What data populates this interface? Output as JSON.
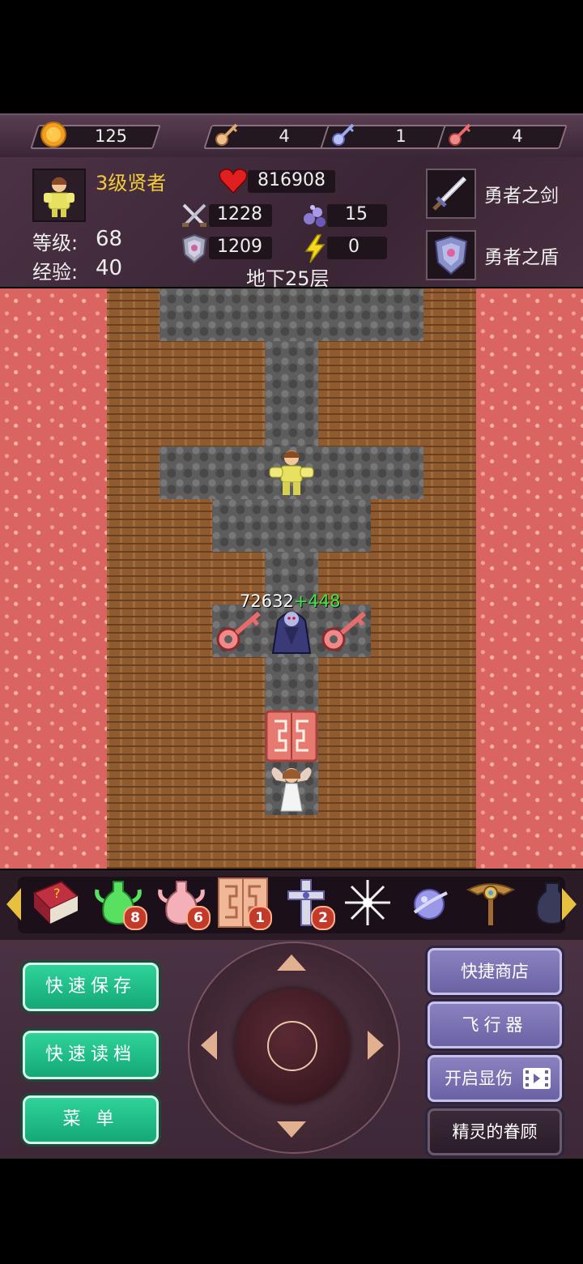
{
  "resources": {
    "gold": "125",
    "yellow_keys": "4",
    "blue_keys": "1",
    "red_keys": "4"
  },
  "hero": {
    "title": "3级贤者",
    "level_label": "等级:",
    "level": "68",
    "exp_label": "经验:",
    "exp": "40",
    "hp": "816908",
    "attack": "1228",
    "defense": "1209",
    "magic_defense": "15",
    "speed": "0"
  },
  "equipment": {
    "weapon": "勇者之剑",
    "shield": "勇者之盾"
  },
  "floor": "地下25层",
  "battle": {
    "enemy_hp": "72632",
    "gain": "+448"
  },
  "items": [
    {
      "icon": "monster-book-icon",
      "count": ""
    },
    {
      "icon": "green-potion-icon",
      "count": "8"
    },
    {
      "icon": "pink-potion-icon",
      "count": "6"
    },
    {
      "icon": "door-icon",
      "count": "1"
    },
    {
      "icon": "cross-icon",
      "count": "2"
    },
    {
      "icon": "snowflake-icon",
      "count": ""
    },
    {
      "icon": "orb-icon",
      "count": ""
    },
    {
      "icon": "wing-staff-icon",
      "count": ""
    },
    {
      "icon": "dark-vase-icon",
      "count": ""
    }
  ],
  "buttons": {
    "quick_save": "快速保存",
    "quick_load": "快速读档",
    "menu": "菜 单",
    "quick_shop": "快捷商店",
    "flyer": "飞行器",
    "show_damage": "开启显伤",
    "fairy": "精灵的眷顾"
  }
}
